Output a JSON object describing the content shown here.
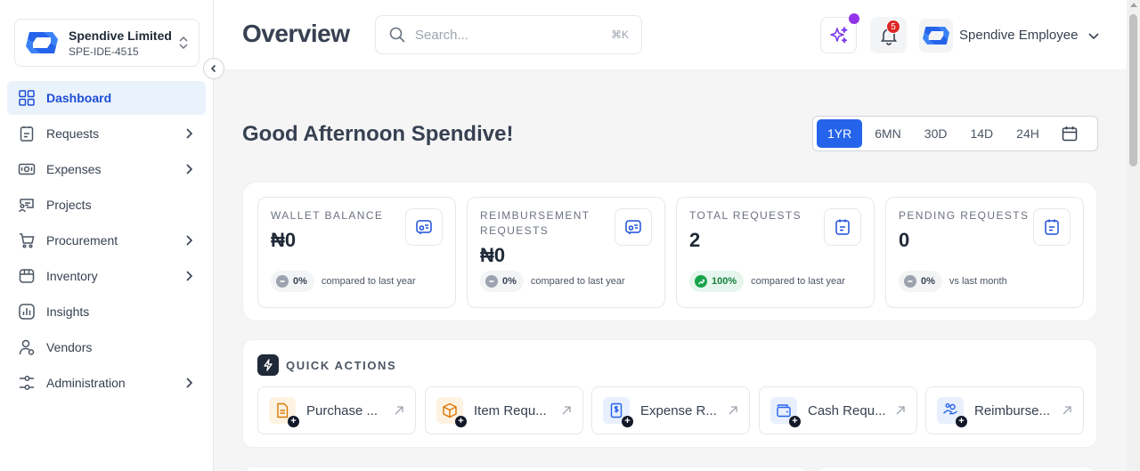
{
  "org": {
    "name": "Spendive Limited",
    "code": "SPE-IDE-4515"
  },
  "sidebar": {
    "items": [
      {
        "label": "Dashboard",
        "icon": "grid-icon",
        "active": true,
        "expandable": false
      },
      {
        "label": "Requests",
        "icon": "clipboard-icon",
        "active": false,
        "expandable": true
      },
      {
        "label": "Expenses",
        "icon": "banknote-icon",
        "active": false,
        "expandable": true
      },
      {
        "label": "Projects",
        "icon": "presentation-icon",
        "active": false,
        "expandable": false
      },
      {
        "label": "Procurement",
        "icon": "cart-icon",
        "active": false,
        "expandable": true
      },
      {
        "label": "Inventory",
        "icon": "package-icon",
        "active": false,
        "expandable": true
      },
      {
        "label": "Insights",
        "icon": "chart-icon",
        "active": false,
        "expandable": false
      },
      {
        "label": "Vendors",
        "icon": "user-icon",
        "active": false,
        "expandable": false
      },
      {
        "label": "Administration",
        "icon": "settings-sliders-icon",
        "active": false,
        "expandable": true
      }
    ]
  },
  "header": {
    "title": "Overview",
    "search_placeholder": "Search...",
    "search_shortcut": "⌘K",
    "notifications_count": "5",
    "user_name": "Spendive Employee"
  },
  "main": {
    "greeting": "Good Afternoon Spendive!",
    "ranges": [
      "1YR",
      "6MN",
      "30D",
      "14D",
      "24H"
    ],
    "selected_range": "1YR",
    "stats": [
      {
        "label": "WALLET BALANCE",
        "value": "₦0",
        "change": "0%",
        "trend": "flat",
        "compare": "compared to last year"
      },
      {
        "label": "REIMBURSEMENT REQUESTS",
        "value": "₦0",
        "change": "0%",
        "trend": "flat",
        "compare": "compared to last year"
      },
      {
        "label": "TOTAL REQUESTS",
        "value": "2",
        "change": "100%",
        "trend": "up",
        "compare": "compared to last year"
      },
      {
        "label": "PENDING REQUESTS",
        "value": "0",
        "change": "0%",
        "trend": "flat",
        "compare": "vs last month"
      }
    ],
    "quick_actions_title": "QUICK ACTIONS",
    "quick_actions": [
      {
        "label": "Purchase ...",
        "icon": "document-icon",
        "color": "#f59e0b"
      },
      {
        "label": "Item Requ...",
        "icon": "box-icon",
        "color": "#f59e0b"
      },
      {
        "label": "Expense R...",
        "icon": "receipt-icon",
        "color": "#2563eb"
      },
      {
        "label": "Cash Requ...",
        "icon": "wallet-icon",
        "color": "#2563eb"
      },
      {
        "label": "Reimburse...",
        "icon": "hand-coins-icon",
        "color": "#2563eb"
      }
    ]
  },
  "colors": {
    "accent": "#2563eb",
    "active_bg": "#eaf2fb",
    "danger": "#dc2626",
    "ai": "#9333ea",
    "success": "#16a34a"
  }
}
